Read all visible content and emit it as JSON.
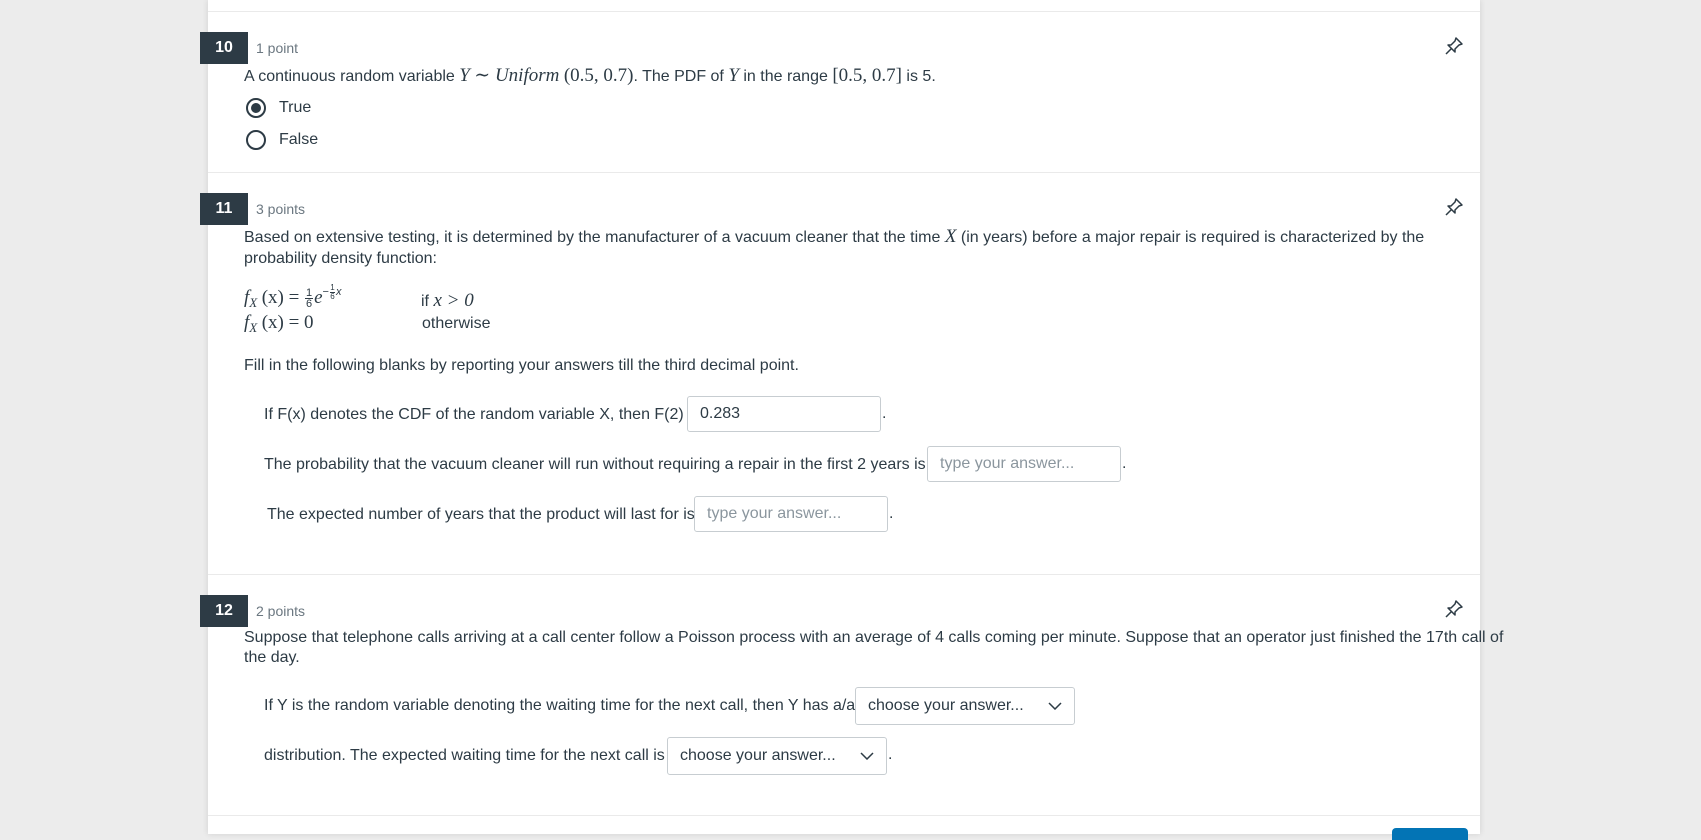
{
  "questions": [
    {
      "number": "10",
      "points": "1 point",
      "text_before": "A continuous random variable ",
      "math_y": "Y",
      "math_dist": "∼ ",
      "math_uniform": "Uniform",
      "math_args": "(0.5, 0.7)",
      "text_mid": ". The PDF of ",
      "math_y2": "Y",
      "text_mid2": " in the range ",
      "math_range": "[0.5, 0.7]",
      "text_after": " is 5.",
      "options": [
        {
          "label": "True",
          "selected": true
        },
        {
          "label": "False",
          "selected": false
        }
      ]
    },
    {
      "number": "11",
      "points": "3 points",
      "text_line1_a": "Based on extensive testing, it is determined by the manufacturer of a vacuum cleaner that the time ",
      "math_x": "X",
      "text_line1_b": " (in years) before a major repair is required is characterized by the",
      "text_line2": "probability density function:",
      "pdf": {
        "row1_lhs": "f",
        "row1_sub": "X",
        "row1_arg": "(x) = ",
        "row1_frac_num": "1",
        "row1_frac_den": "6",
        "row1_e": "e",
        "row1_exp": "−",
        "row1_exp_num": "1",
        "row1_exp_den": "6",
        "row1_exp_x": "x",
        "row1_cond_if": "if ",
        "row1_cond": "x > 0",
        "row2_lhs": "f",
        "row2_sub": "X",
        "row2_arg": "(x) = 0",
        "row2_cond": "otherwise"
      },
      "instruction": "Fill in the following blanks by reporting your answers till the third decimal point.",
      "blanks": [
        {
          "prompt": "If F(x) denotes the CDF of the random variable X, then F(2) =",
          "value": "0.283",
          "placeholder": "type your answer..."
        },
        {
          "prompt": "The probability that the vacuum cleaner will run without requiring a repair in the first 2 years is",
          "value": "",
          "placeholder": "type your answer..."
        },
        {
          "prompt": "The expected number of years that the product will last for is",
          "value": "",
          "placeholder": "type your answer..."
        }
      ]
    },
    {
      "number": "12",
      "points": "2 points",
      "text_line1": "Suppose that telephone calls arriving at a call center follow a Poisson process with an average of 4 calls coming per minute. Suppose that an operator just finished the 17th call of",
      "text_line2": "the day.",
      "selects": [
        {
          "prompt": "If Y is the random variable denoting the waiting time for the next call, then Y has a/an",
          "value": "choose your answer..."
        },
        {
          "prompt": "distribution. The expected waiting time for the next call is",
          "value": "choose your answer..."
        }
      ]
    }
  ],
  "punctuation": ".",
  "icons": {
    "pin": "pin-icon",
    "dropdown": "chevron-down-icon"
  },
  "colors": {
    "header_badge": "#2d3b45",
    "text": "#2d3b45",
    "muted": "#6b7780",
    "accent": "#0374b5"
  }
}
